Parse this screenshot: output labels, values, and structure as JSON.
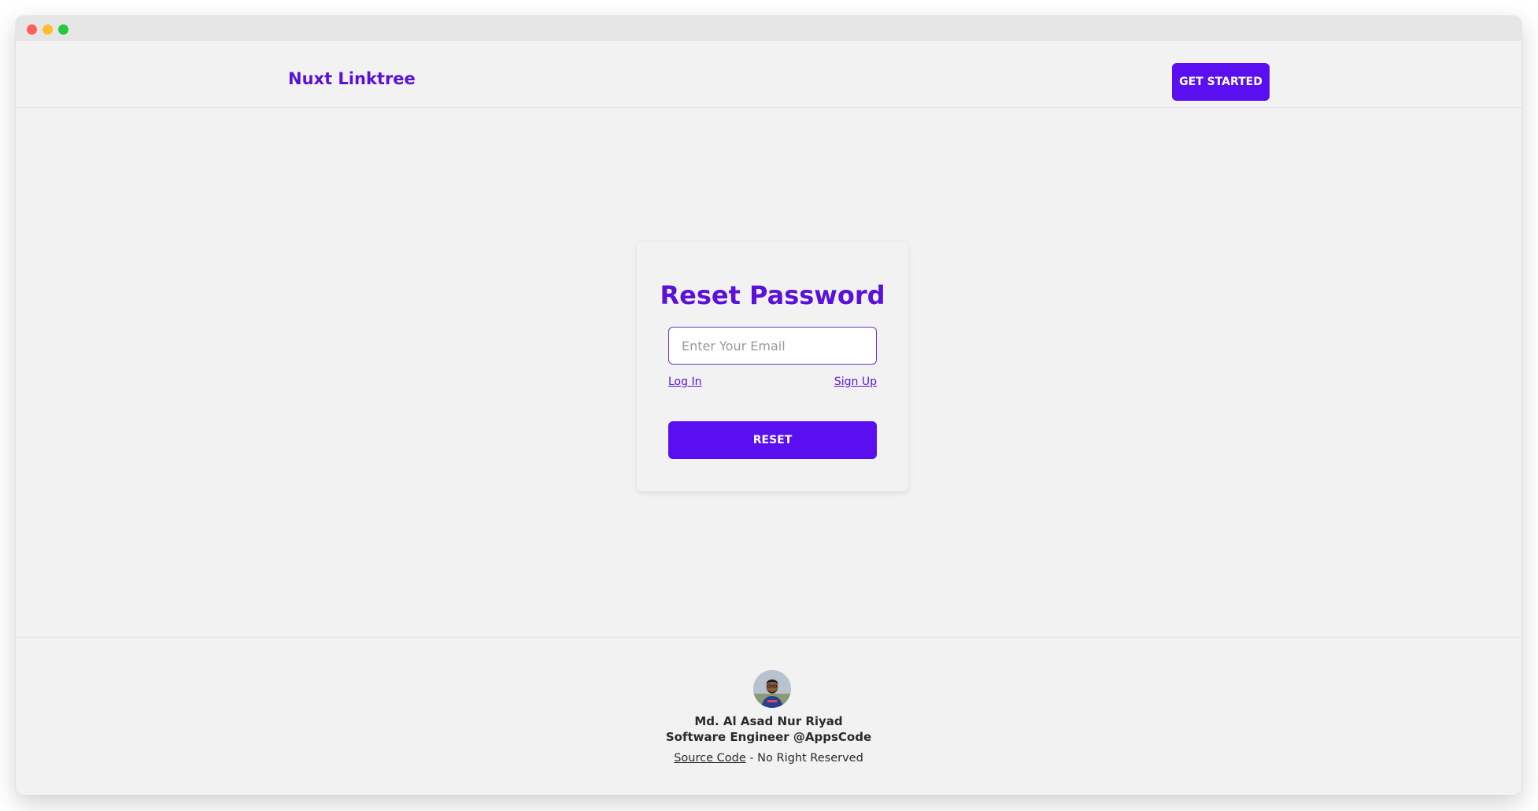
{
  "navbar": {
    "brand": "Nuxt Linktree",
    "cta_label": "GET STARTED"
  },
  "reset_form": {
    "title": "Reset Password",
    "email_placeholder": "Enter Your Email",
    "email_value": "",
    "login_link": "Log In",
    "signup_link": "Sign Up",
    "submit_label": "RESET"
  },
  "footer": {
    "author_name": "Md. Al Asad Nur Riyad",
    "author_role": "Software Engineer @AppsCode",
    "source_link": "Source Code",
    "rights_text": " - No Right Reserved"
  },
  "colors": {
    "accent": "#5a0ff0",
    "brand_text": "#5a11d9",
    "background": "#f2f2f2"
  }
}
